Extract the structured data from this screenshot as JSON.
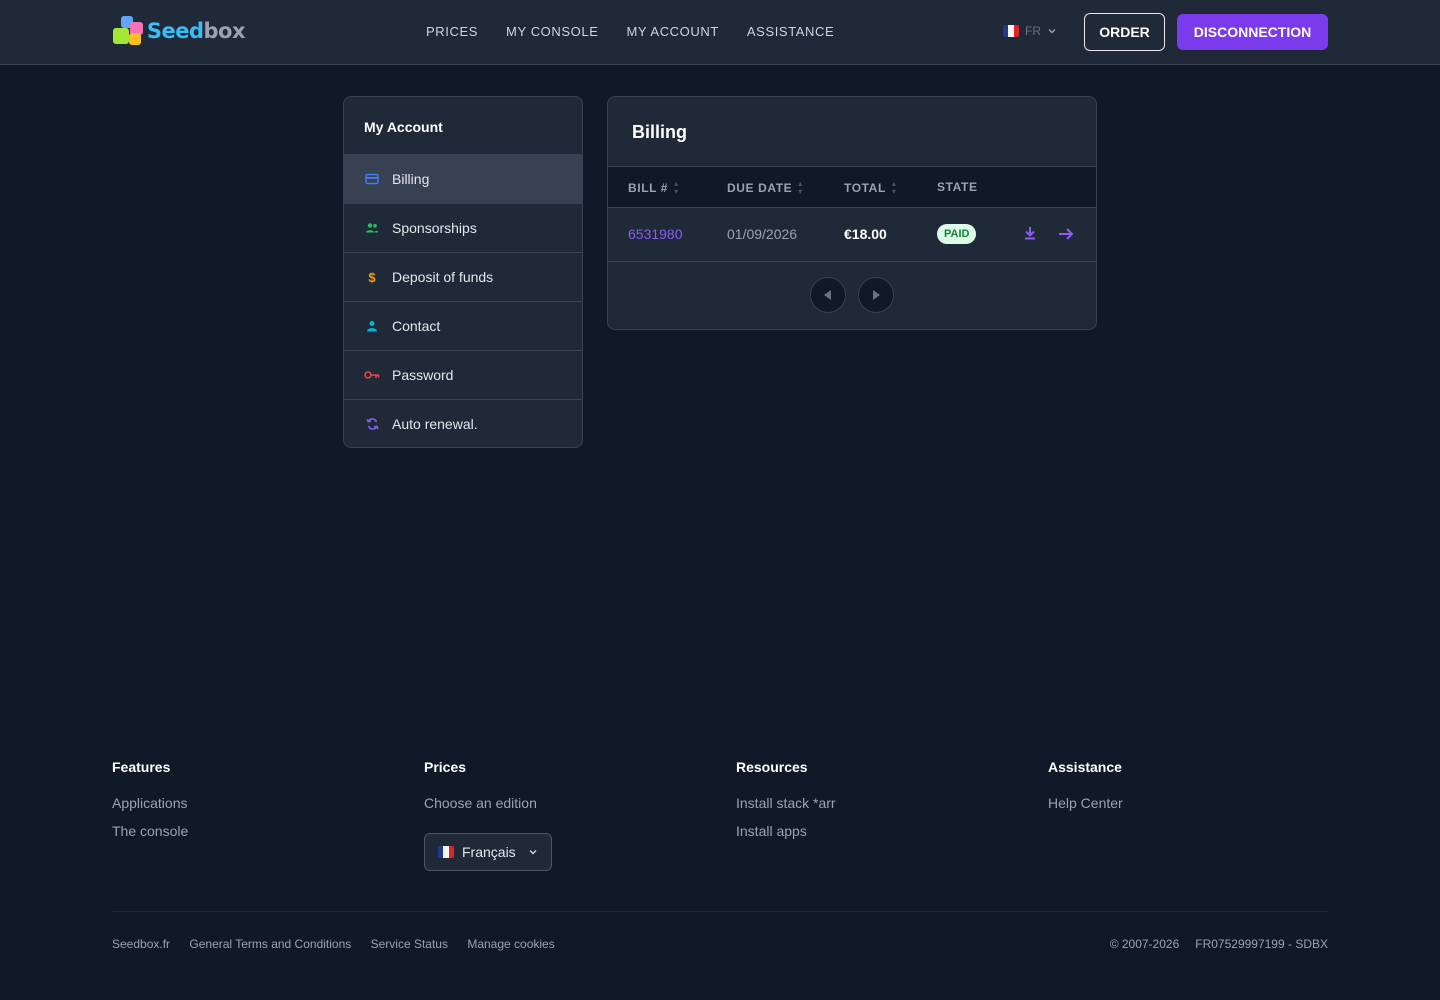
{
  "brand": {
    "logo_part1": "Seed",
    "logo_part2": "box"
  },
  "nav": {
    "items": [
      "PRICES",
      "MY CONSOLE",
      "MY ACCOUNT",
      "ASSISTANCE"
    ],
    "language": "FR",
    "order_label": "ORDER",
    "disconnect_label": "DISCONNECTION"
  },
  "sidebar": {
    "title": "My Account",
    "items": [
      {
        "label": "Billing",
        "icon": "credit-card-icon",
        "color": "#3b82f6",
        "active": true
      },
      {
        "label": "Sponsorships",
        "icon": "users-icon",
        "color": "#22c55e"
      },
      {
        "label": "Deposit of funds",
        "icon": "dollar-icon",
        "color": "#f59e0b"
      },
      {
        "label": "Contact",
        "icon": "user-icon",
        "color": "#06b6d4"
      },
      {
        "label": "Password",
        "icon": "key-icon",
        "color": "#ef4444"
      },
      {
        "label": "Auto renewal.",
        "icon": "refresh-icon",
        "color": "#8b5cf6"
      }
    ]
  },
  "billing": {
    "title": "Billing",
    "columns": [
      "BILL #",
      "DUE DATE",
      "TOTAL",
      "STATE"
    ],
    "rows": [
      {
        "bill": "6531980",
        "due_date": "01/09/2026",
        "total": "€18.00",
        "state": "PAID"
      }
    ]
  },
  "footer": {
    "columns": [
      {
        "title": "Features",
        "links": [
          "Applications",
          "The console"
        ]
      },
      {
        "title": "Prices",
        "links": [
          "Choose an edition"
        ]
      },
      {
        "title": "Resources",
        "links": [
          "Install stack *arr",
          "Install apps"
        ]
      },
      {
        "title": "Assistance",
        "links": [
          "Help Center"
        ]
      }
    ],
    "language_select": "Français",
    "bottom_links": [
      "Seedbox.fr",
      "General Terms and Conditions",
      "Service Status",
      "Manage cookies"
    ],
    "copyright": "© 2007-2026",
    "company_id": "FR07529997199 - SDBX"
  },
  "colors": {
    "accent": "#7c3aed",
    "background": "#111827",
    "panel": "#1f2937",
    "paid_badge": "#dcfce7"
  }
}
